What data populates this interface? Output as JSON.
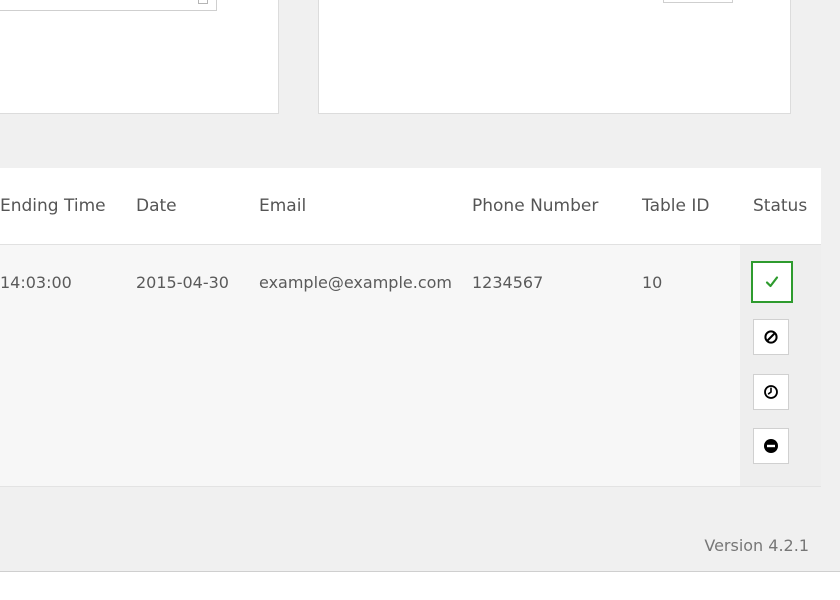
{
  "table": {
    "columns": [
      "Ending Time",
      "Date",
      "Email",
      "Phone Number",
      "Table ID",
      "Status"
    ],
    "rows": [
      {
        "ending_time": "14:03:00",
        "date": "2015-04-30",
        "email": "example@example.com",
        "phone": "1234567",
        "table_id": "10"
      }
    ]
  },
  "status_buttons": [
    {
      "icon": "check-icon",
      "state": "active",
      "color": "#2e9b2e"
    },
    {
      "icon": "ban-icon",
      "state": "inactive"
    },
    {
      "icon": "clock-icon",
      "state": "inactive"
    },
    {
      "icon": "minus-circle-icon",
      "state": "inactive"
    }
  ],
  "footer": {
    "version": "Version 4.2.1"
  }
}
